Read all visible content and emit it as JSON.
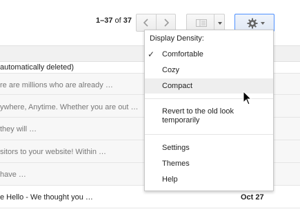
{
  "toolbar": {
    "pager": {
      "range": "1–37",
      "of": "of",
      "total": "37"
    },
    "prev_icon": "chevron-left-icon",
    "next_icon": "chevron-right-icon",
    "layout_icon": "reading-pane-icon",
    "settings_icon": "gear-icon"
  },
  "messages": [
    {
      "snippet": "automatically deleted)",
      "date": ""
    },
    {
      "snippet": "re are millions who are already …",
      "date": ""
    },
    {
      "snippet": "ywhere, Anytime. Whether you are out …",
      "date": ""
    },
    {
      "snippet": "they will …",
      "date": ""
    },
    {
      "snippet": "sitors to your website! Within …",
      "date": ""
    },
    {
      "snippet": "have …",
      "date": ""
    },
    {
      "snippet": "e Hello - We thought you …",
      "date": "Oct 27"
    }
  ],
  "settings_menu": {
    "heading": "Display Density:",
    "density_options": [
      {
        "label": "Comfortable",
        "checked": true
      },
      {
        "label": "Cozy",
        "checked": false
      },
      {
        "label": "Compact",
        "checked": false,
        "hovered": true
      }
    ],
    "revert": "Revert to the old look temporarily",
    "items": [
      "Settings",
      "Themes",
      "Help"
    ]
  },
  "colors": {
    "accent_border": "#4d90fe",
    "hover_bg": "#eeeeee"
  }
}
